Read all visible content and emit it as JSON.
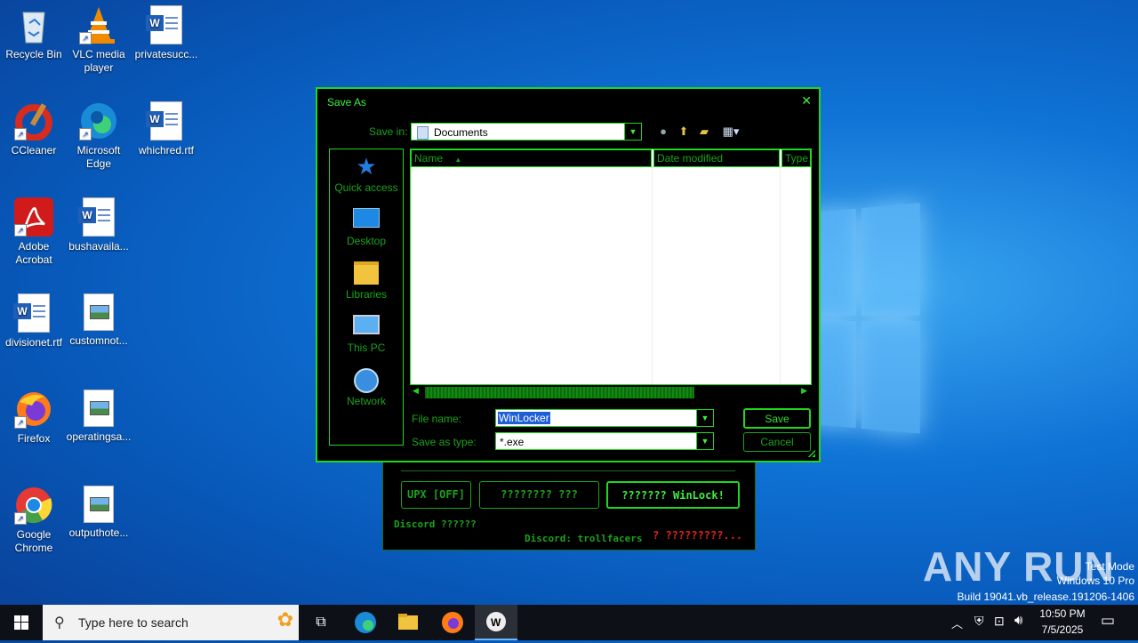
{
  "desktop": {
    "icons": [
      {
        "label": "Recycle Bin",
        "icon": "recycle-bin-icon"
      },
      {
        "label": "VLC media player",
        "icon": "vlc-icon"
      },
      {
        "label": "privatesucc...",
        "icon": "word-doc-icon"
      },
      {
        "label": "CCleaner",
        "icon": "ccleaner-icon"
      },
      {
        "label": "Microsoft Edge",
        "icon": "edge-icon"
      },
      {
        "label": "whichred.rtf",
        "icon": "word-doc-icon"
      },
      {
        "label": "Adobe Acrobat",
        "icon": "acrobat-icon"
      },
      {
        "label": "bushavaila...",
        "icon": "word-doc-icon"
      },
      {
        "label": "divisionet.rtf",
        "icon": "word-doc-icon"
      },
      {
        "label": "customnot...",
        "icon": "image-doc-icon"
      },
      {
        "label": "Firefox",
        "icon": "firefox-icon"
      },
      {
        "label": "operatingsa...",
        "icon": "image-doc-icon"
      },
      {
        "label": "Google Chrome",
        "icon": "chrome-icon"
      },
      {
        "label": "outputhote...",
        "icon": "image-doc-icon"
      }
    ]
  },
  "dialog": {
    "title": "Save As",
    "close": "✕",
    "save_in_label": "Save in:",
    "save_in_value": "Documents",
    "places": [
      "Quick access",
      "Desktop",
      "Libraries",
      "This PC",
      "Network"
    ],
    "columns": [
      "Name",
      "Date modified",
      "Type"
    ],
    "sort_indicator": "▲",
    "file_name_label": "File name:",
    "file_name_value": "WinLocker",
    "save_type_label": "Save as type:",
    "save_type_value": "*.exe",
    "save_button": "Save",
    "cancel_button": "Cancel",
    "accent_color": "#1ed81e"
  },
  "app": {
    "upx_button": "UPX [OFF]",
    "mid_button": "???????? ???",
    "create_button": "??????? WinLock!",
    "discord_left": "Discord ??????",
    "discord_right": "Discord: trollfacers",
    "red_text": "? ?????????..."
  },
  "watermark": {
    "logo": "ANY RUN",
    "line1": "Test Mode",
    "line2": "Windows 10 Pro",
    "line3": "Build 19041.vb_release.191206-1406"
  },
  "taskbar": {
    "search_placeholder": "Type here to search",
    "time": "10:50 PM",
    "date": "7/5/2025"
  }
}
